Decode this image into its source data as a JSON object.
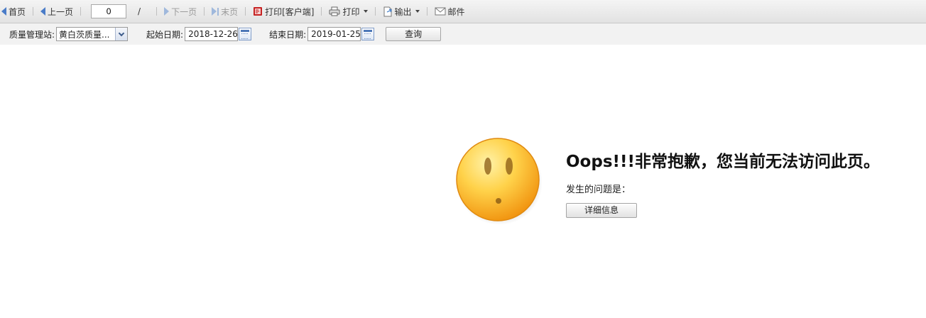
{
  "toolbar": {
    "first_page": "首页",
    "prev_page": "上一页",
    "page_number": "0",
    "page_separator": "/",
    "next_page": "下一页",
    "last_page": "末页",
    "print_client": "打印[客户端]",
    "print": "打印",
    "export": "输出",
    "email": "邮件"
  },
  "filters": {
    "station_label": "质量管理站:",
    "station_value": "黄白茨质量...",
    "start_label": "起始日期:",
    "start_value": "2018-12-26",
    "end_label": "结束日期:",
    "end_value": "2019-01-25",
    "query_button": "查询"
  },
  "error": {
    "title": "Oops!!!非常抱歉，您当前无法访问此页。",
    "subtitle": "发生的问题是：",
    "details_button": "详细信息",
    "icon": "sad-face-icon"
  },
  "colors": {
    "smiley_light": "#ffe27a",
    "smiley_dark": "#f29a0f",
    "nav_arrow": "#4a7cc8"
  }
}
